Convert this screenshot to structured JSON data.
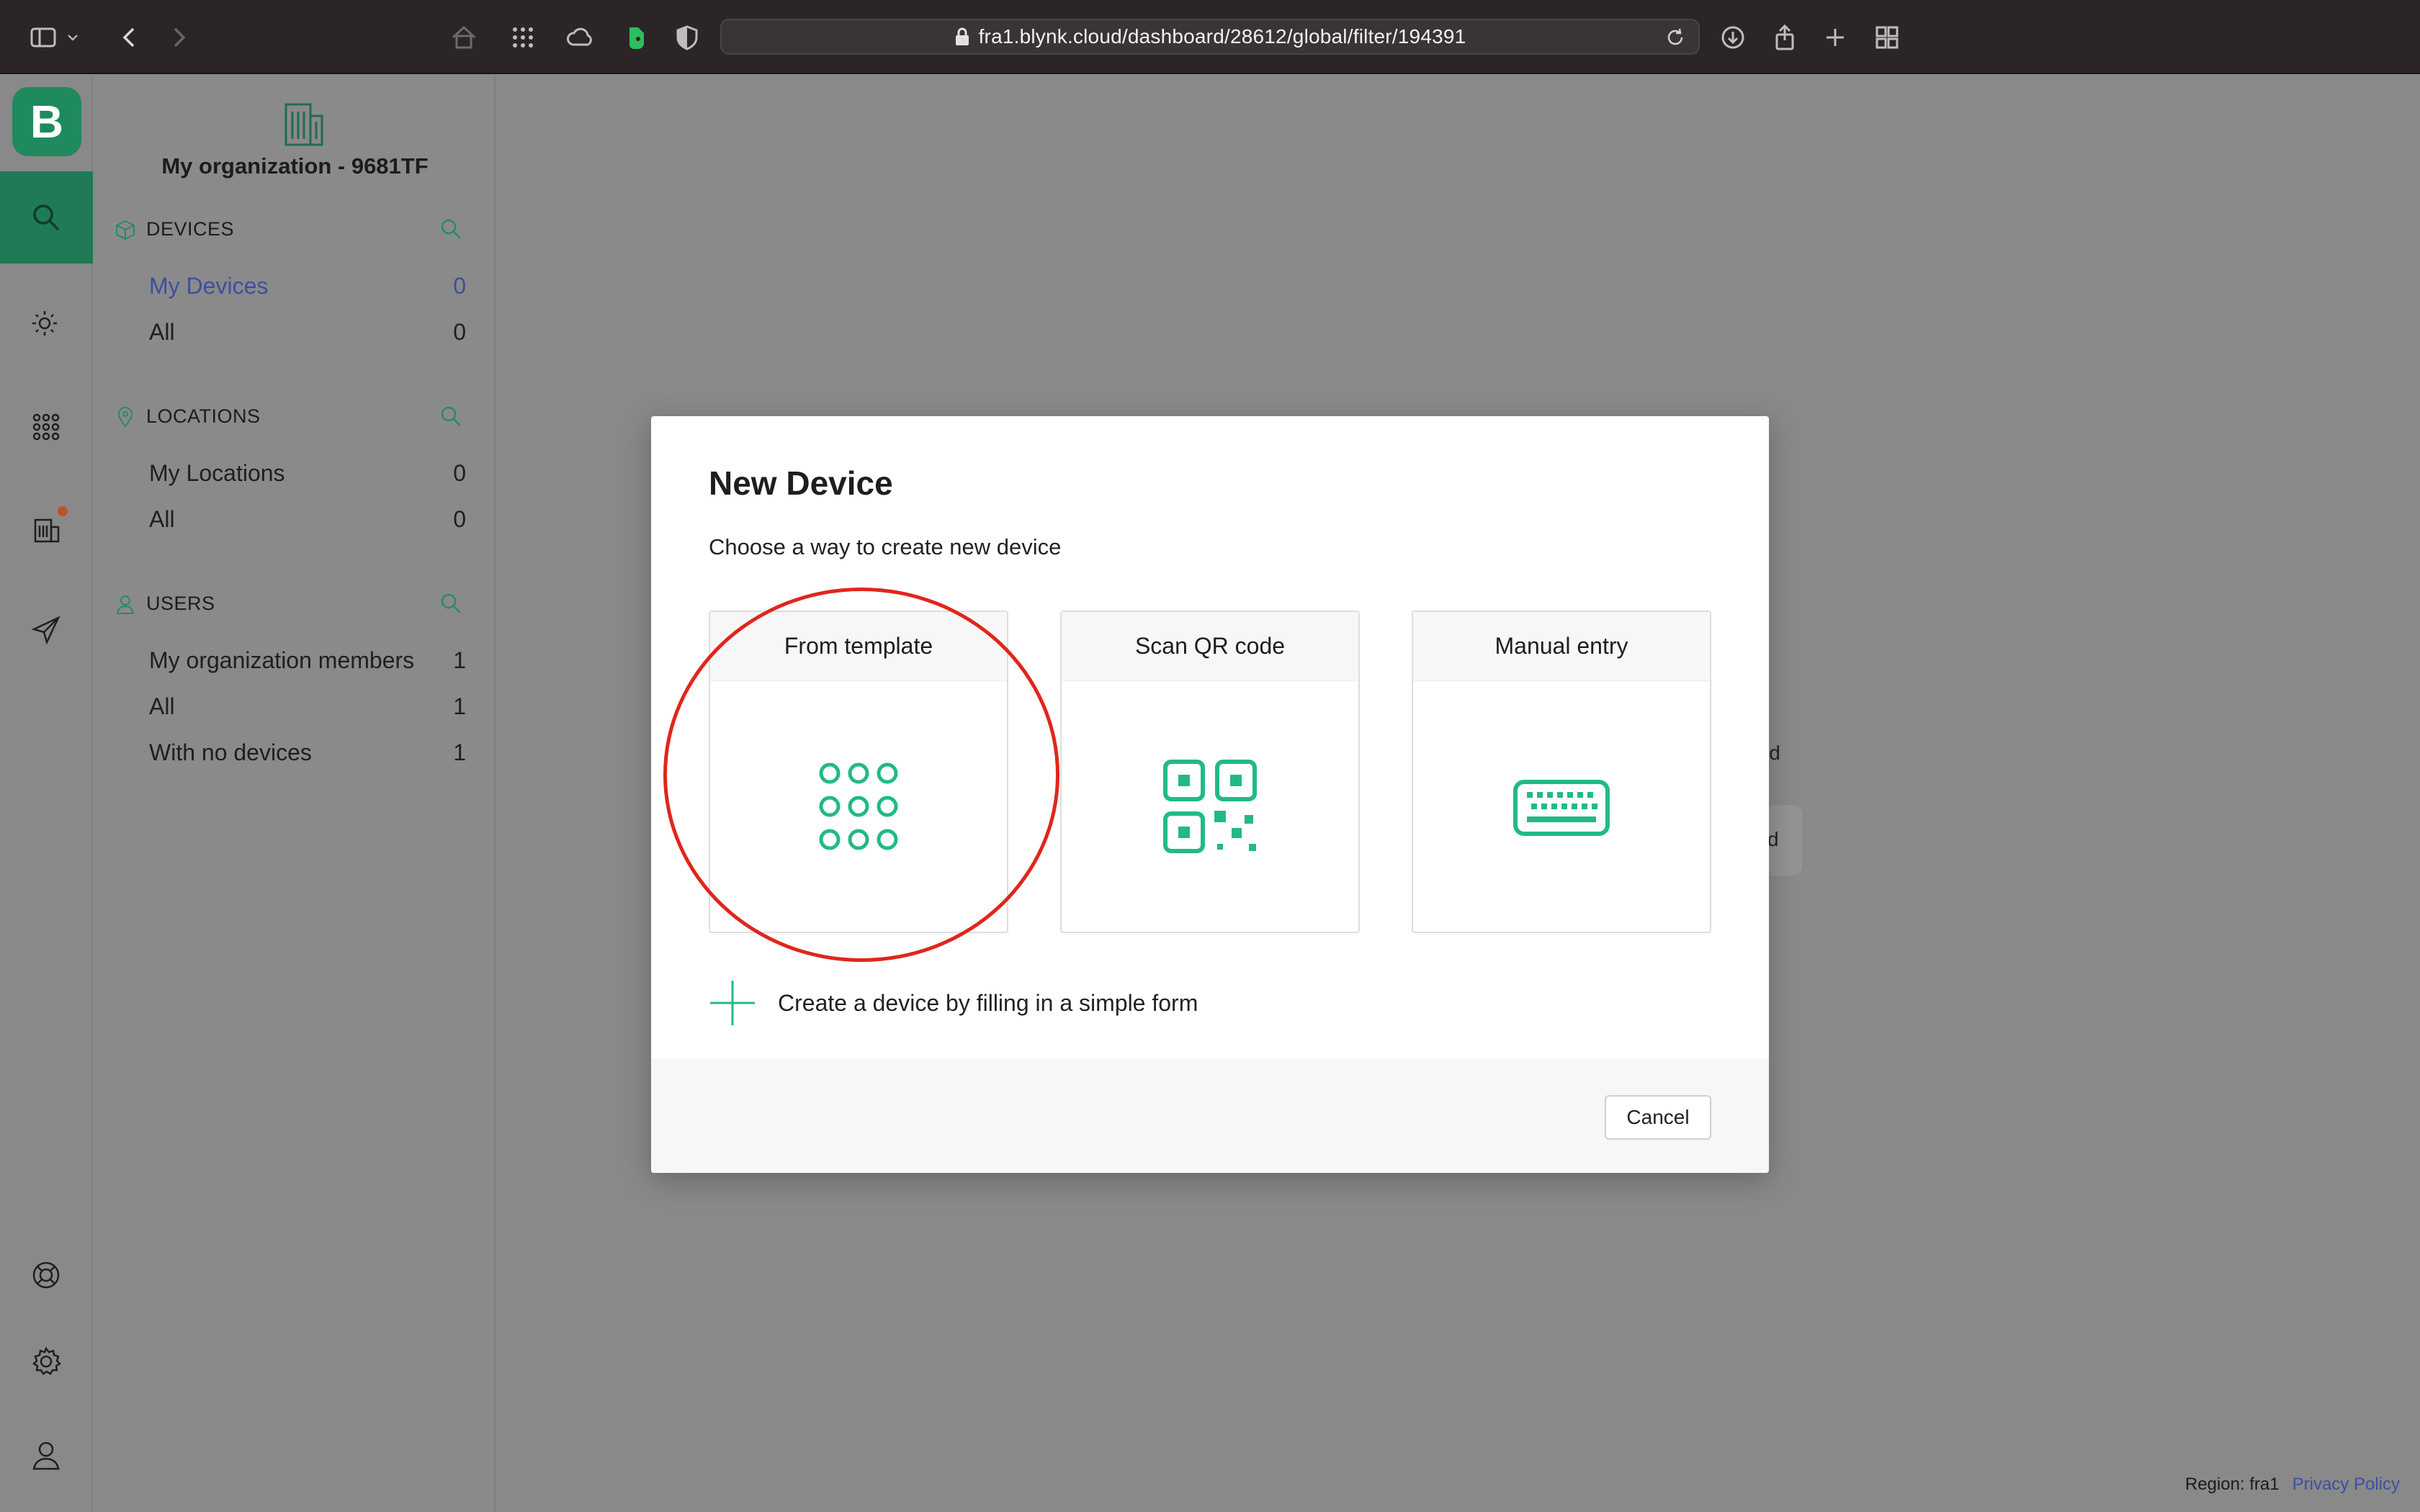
{
  "browser": {
    "url": "fra1.blynk.cloud/dashboard/28612/global/filter/194391"
  },
  "rail": {
    "logo": "B",
    "icons": [
      "search-icon",
      "sun-icon",
      "grid-icon",
      "building-icon",
      "send-icon",
      "help-icon",
      "settings-icon",
      "user-icon"
    ]
  },
  "sidebar": {
    "org_name": "My organization - 9681TF",
    "devices": {
      "header": "DEVICES",
      "items": [
        {
          "label": "My Devices",
          "count": "0"
        },
        {
          "label": "All",
          "count": "0"
        }
      ]
    },
    "locations": {
      "header": "LOCATIONS",
      "items": [
        {
          "label": "My Locations",
          "count": "0"
        },
        {
          "label": "All",
          "count": "0"
        }
      ]
    },
    "users": {
      "header": "USERS",
      "items": [
        {
          "label": "My organization members",
          "count": "1"
        },
        {
          "label": "All",
          "count": "1"
        },
        {
          "label": "With no devices",
          "count": "1"
        }
      ]
    }
  },
  "background": {
    "fragment_1": "id",
    "fragment_2": "d"
  },
  "modal": {
    "title": "New Device",
    "subtitle": "Choose a way to create new device",
    "options": [
      {
        "label": "From template",
        "icon": "dots-grid-icon"
      },
      {
        "label": "Scan QR code",
        "icon": "qr-code-icon"
      },
      {
        "label": "Manual entry",
        "icon": "keyboard-icon"
      }
    ],
    "form_link": "Create a device by filling in a simple form",
    "cancel": "Cancel"
  },
  "footer": {
    "region": "Region: fra1",
    "privacy": "Privacy Policy"
  },
  "colors": {
    "accent": "#23b987",
    "highlight": "#e0261c",
    "active_link": "#3d4fa0"
  }
}
